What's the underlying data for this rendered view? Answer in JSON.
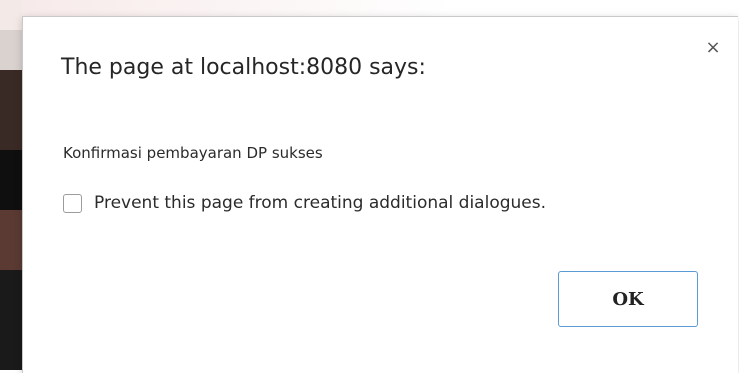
{
  "dialog": {
    "title": "The page at localhost:8080 says:",
    "message": "Konfirmasi pembayaran DP sukses",
    "prevent_checkbox": {
      "label": "Prevent this page from creating additional dialogues.",
      "checked": false
    },
    "ok_label": "OK",
    "close_icon": "close-icon",
    "colors": {
      "ok_border": "#5b9bd5",
      "text": "#262626"
    }
  }
}
